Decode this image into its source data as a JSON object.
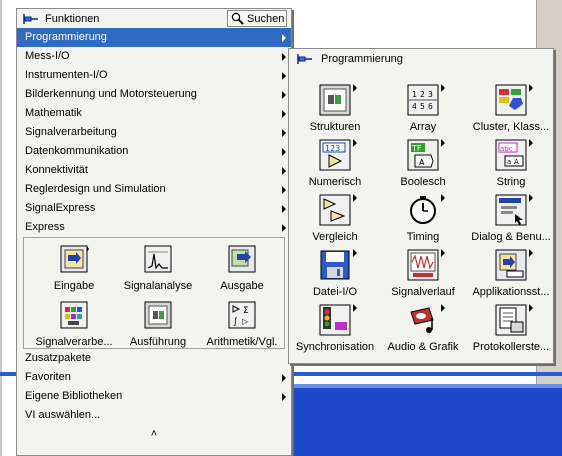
{
  "palette": {
    "title": "Funktionen",
    "search_label": "Suchen",
    "menu_top": [
      {
        "label": "Programmierung",
        "selected": true,
        "has_submenu": true
      },
      {
        "label": "Mess-I/O",
        "selected": false,
        "has_submenu": true
      },
      {
        "label": "Instrumenten-I/O",
        "selected": false,
        "has_submenu": true
      },
      {
        "label": "Bilderkennung und Motorsteuerung",
        "selected": false,
        "has_submenu": true
      },
      {
        "label": "Mathematik",
        "selected": false,
        "has_submenu": true
      },
      {
        "label": "Signalverarbeitung",
        "selected": false,
        "has_submenu": true
      },
      {
        "label": "Datenkommunikation",
        "selected": false,
        "has_submenu": true
      },
      {
        "label": "Konnektivität",
        "selected": false,
        "has_submenu": true
      },
      {
        "label": "Reglerdesign und Simulation",
        "selected": false,
        "has_submenu": true
      },
      {
        "label": "SignalExpress",
        "selected": false,
        "has_submenu": true
      },
      {
        "label": "Express",
        "selected": false,
        "has_submenu": true
      }
    ],
    "express_icons": [
      {
        "label": "Eingabe",
        "icon": "input-icon"
      },
      {
        "label": "Signalanalyse",
        "icon": "signal-analysis-icon"
      },
      {
        "label": "Ausgabe",
        "icon": "output-icon"
      },
      {
        "label": "Signalverarbe...",
        "icon": "signal-processing-icon"
      },
      {
        "label": "Ausführung",
        "icon": "execution-icon"
      },
      {
        "label": "Arithmetik/Vgl.",
        "icon": "arithmetic-icon"
      }
    ],
    "menu_bottom": [
      {
        "label": "Zusatzpakete",
        "has_submenu": false
      },
      {
        "label": "Favoriten",
        "has_submenu": true
      },
      {
        "label": "Eigene Bibliotheken",
        "has_submenu": true
      },
      {
        "label": "VI auswählen...",
        "has_submenu": false
      }
    ],
    "collapse_glyph": "˄"
  },
  "subpalette": {
    "title": "Programmierung",
    "items": [
      {
        "label": "Strukturen",
        "icon": "structures-icon"
      },
      {
        "label": "Array",
        "icon": "array-icon"
      },
      {
        "label": "Cluster, Klass...",
        "icon": "cluster-icon"
      },
      {
        "label": "Numerisch",
        "icon": "numeric-icon"
      },
      {
        "label": "Boolesch",
        "icon": "boolean-icon"
      },
      {
        "label": "String",
        "icon": "string-icon"
      },
      {
        "label": "Vergleich",
        "icon": "comparison-icon"
      },
      {
        "label": "Timing",
        "icon": "timing-icon"
      },
      {
        "label": "Dialog & Benu...",
        "icon": "dialog-icon"
      },
      {
        "label": "Datei-I/O",
        "icon": "file-io-icon"
      },
      {
        "label": "Signalverlauf",
        "icon": "waveform-icon"
      },
      {
        "label": "Applikationsst...",
        "icon": "app-control-icon"
      },
      {
        "label": "Synchronisation",
        "icon": "synchronization-icon"
      },
      {
        "label": "Audio & Grafik",
        "icon": "audio-graphics-icon"
      },
      {
        "label": "Protokollerste...",
        "icon": "report-icon"
      }
    ]
  },
  "colors": {
    "selection": "#316ac5",
    "palette_bg": "#f3f3f0",
    "taskbar_blue": "#1d49c9"
  }
}
